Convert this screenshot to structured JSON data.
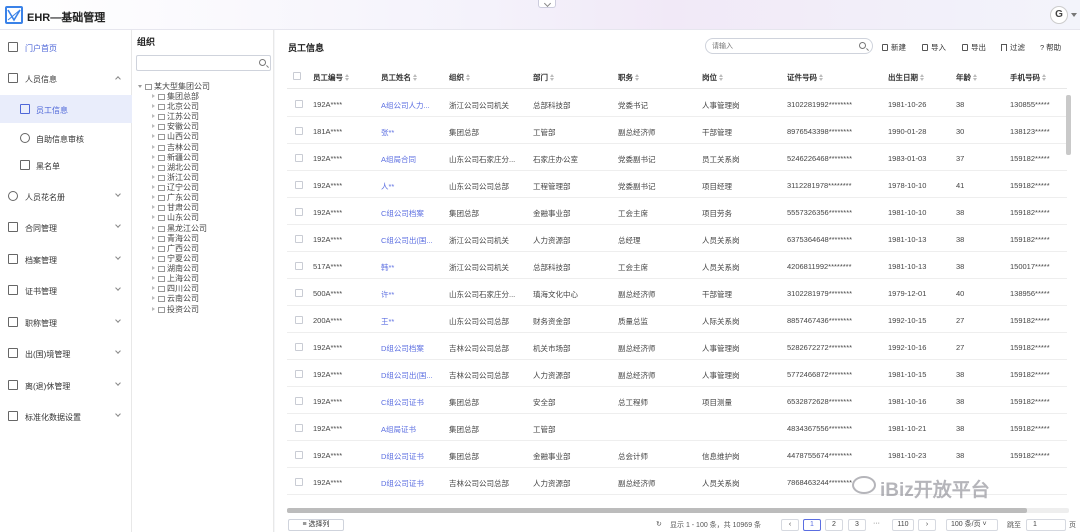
{
  "app": {
    "title": "EHR—基础管理",
    "avatar": "G"
  },
  "sidebar": {
    "items": [
      {
        "label": "门户首页",
        "active": true
      },
      {
        "label": "人员信息",
        "expanded": true
      },
      {
        "label": "员工信息",
        "active": true,
        "sub": true
      },
      {
        "label": "自助信息审核",
        "sub": true
      },
      {
        "label": "黑名单",
        "sub": true
      },
      {
        "label": "人员花名册"
      },
      {
        "label": "合同管理"
      },
      {
        "label": "档案管理"
      },
      {
        "label": "证书管理"
      },
      {
        "label": "职称管理"
      },
      {
        "label": "出(国)境管理"
      },
      {
        "label": "离(退)休管理"
      },
      {
        "label": "标准化数据设置"
      }
    ]
  },
  "tree": {
    "title": "组织",
    "root": "某大型集团公司",
    "children": [
      "集团总部",
      "北京公司",
      "江苏公司",
      "安徽公司",
      "山西公司",
      "吉林公司",
      "新疆公司",
      "湖北公司",
      "浙江公司",
      "辽宁公司",
      "广东公司",
      "甘肃公司",
      "山东公司",
      "黑龙江公司",
      "青海公司",
      "广西公司",
      "宁夏公司",
      "湖南公司",
      "上海公司",
      "四川公司",
      "云南公司",
      "投资公司"
    ]
  },
  "main": {
    "title": "员工信息",
    "search_placeholder": "请输入",
    "toolbar": {
      "new": "新建",
      "import": "导入",
      "export": "导出",
      "filter": "过滤",
      "help": "帮助"
    },
    "columns": [
      "员工编号",
      "员工姓名",
      "组织",
      "部门",
      "职务",
      "岗位",
      "证件号码",
      "出生日期",
      "年龄",
      "手机号码"
    ],
    "rows": [
      [
        "192A****",
        "A组公司人力...",
        "浙江公司公司机关",
        "总部科技部",
        "党委书记",
        "人事管理岗",
        "3102281992********",
        "1981-10-26",
        "38",
        "130855*****"
      ],
      [
        "181A****",
        "张**",
        "集团总部",
        "工管部",
        "副总经济师",
        "干部管理",
        "8976543398********",
        "1990-01-28",
        "30",
        "138123*****"
      ],
      [
        "192A****",
        "A组局合同",
        "山东公司石家庄分...",
        "石家庄办公室",
        "党委副书记",
        "员工关系岗",
        "5246226468********",
        "1983-01-03",
        "37",
        "159182*****"
      ],
      [
        "192A****",
        "人**",
        "山东公司公司总部",
        "工程管理部",
        "党委副书记",
        "项目经理",
        "3112281978********",
        "1978-10-10",
        "41",
        "159182*****"
      ],
      [
        "192A****",
        "C组公司档案",
        "集团总部",
        "金融事业部",
        "工会主席",
        "项目劳务",
        "5557326356********",
        "1981-10-10",
        "38",
        "159182*****"
      ],
      [
        "192A****",
        "C组公司出(国...",
        "浙江公司公司机关",
        "人力资源部",
        "总经理",
        "人员关系岗",
        "6375364648********",
        "1981-10-13",
        "38",
        "159182*****"
      ],
      [
        "517A****",
        "韩**",
        "浙江公司公司机关",
        "总部科技部",
        "工会主席",
        "人员关系岗",
        "4206811992********",
        "1981-10-13",
        "38",
        "150017*****"
      ],
      [
        "500A****",
        "许**",
        "山东公司石家庄分...",
        "瑱海文化中心",
        "副总经济师",
        "干部管理",
        "3102281979********",
        "1979-12-01",
        "40",
        "138956*****"
      ],
      [
        "200A****",
        "王**",
        "山东公司公司总部",
        "财务资金部",
        "质量总监",
        "人际关系岗",
        "8857467436********",
        "1992-10-15",
        "27",
        "159182*****"
      ],
      [
        "192A****",
        "D组公司档案",
        "吉林公司公司总部",
        "机关市场部",
        "副总经济师",
        "人事管理岗",
        "5282672272********",
        "1992-10-16",
        "27",
        "159182*****"
      ],
      [
        "192A****",
        "D组公司出(国...",
        "吉林公司公司总部",
        "人力资源部",
        "副总经济师",
        "人事管理岗",
        "5772466872********",
        "1981-10-15",
        "38",
        "159182*****"
      ],
      [
        "192A****",
        "C组公司证书",
        "集团总部",
        "安全部",
        "总工程师",
        "项目测量",
        "6532872628********",
        "1981-10-16",
        "38",
        "159182*****"
      ],
      [
        "192A****",
        "A组局证书",
        "集团总部",
        "工管部",
        "",
        "",
        "4834367556********",
        "1981-10-21",
        "38",
        "159182*****"
      ],
      [
        "192A****",
        "D组公司证书",
        "集团总部",
        "金融事业部",
        "总会计师",
        "信息维护岗",
        "4478755674********",
        "1981-10-23",
        "38",
        "159182*****"
      ],
      [
        "192A****",
        "D组公司证书",
        "吉林公司公司总部",
        "人力资源部",
        "副总经济师",
        "人员关系岗",
        "7868463244********",
        "",
        "",
        ""
      ]
    ],
    "footer": {
      "select_columns": "选择列",
      "summary": "显示 1 - 100 条，共 10969 条",
      "pages": [
        "1",
        "2",
        "3",
        "···",
        "110"
      ],
      "page_size": "100 条/页",
      "jump_label": "跳至",
      "jump_value": "1",
      "page_unit": "页"
    }
  },
  "watermark": "iBiz开放平台"
}
